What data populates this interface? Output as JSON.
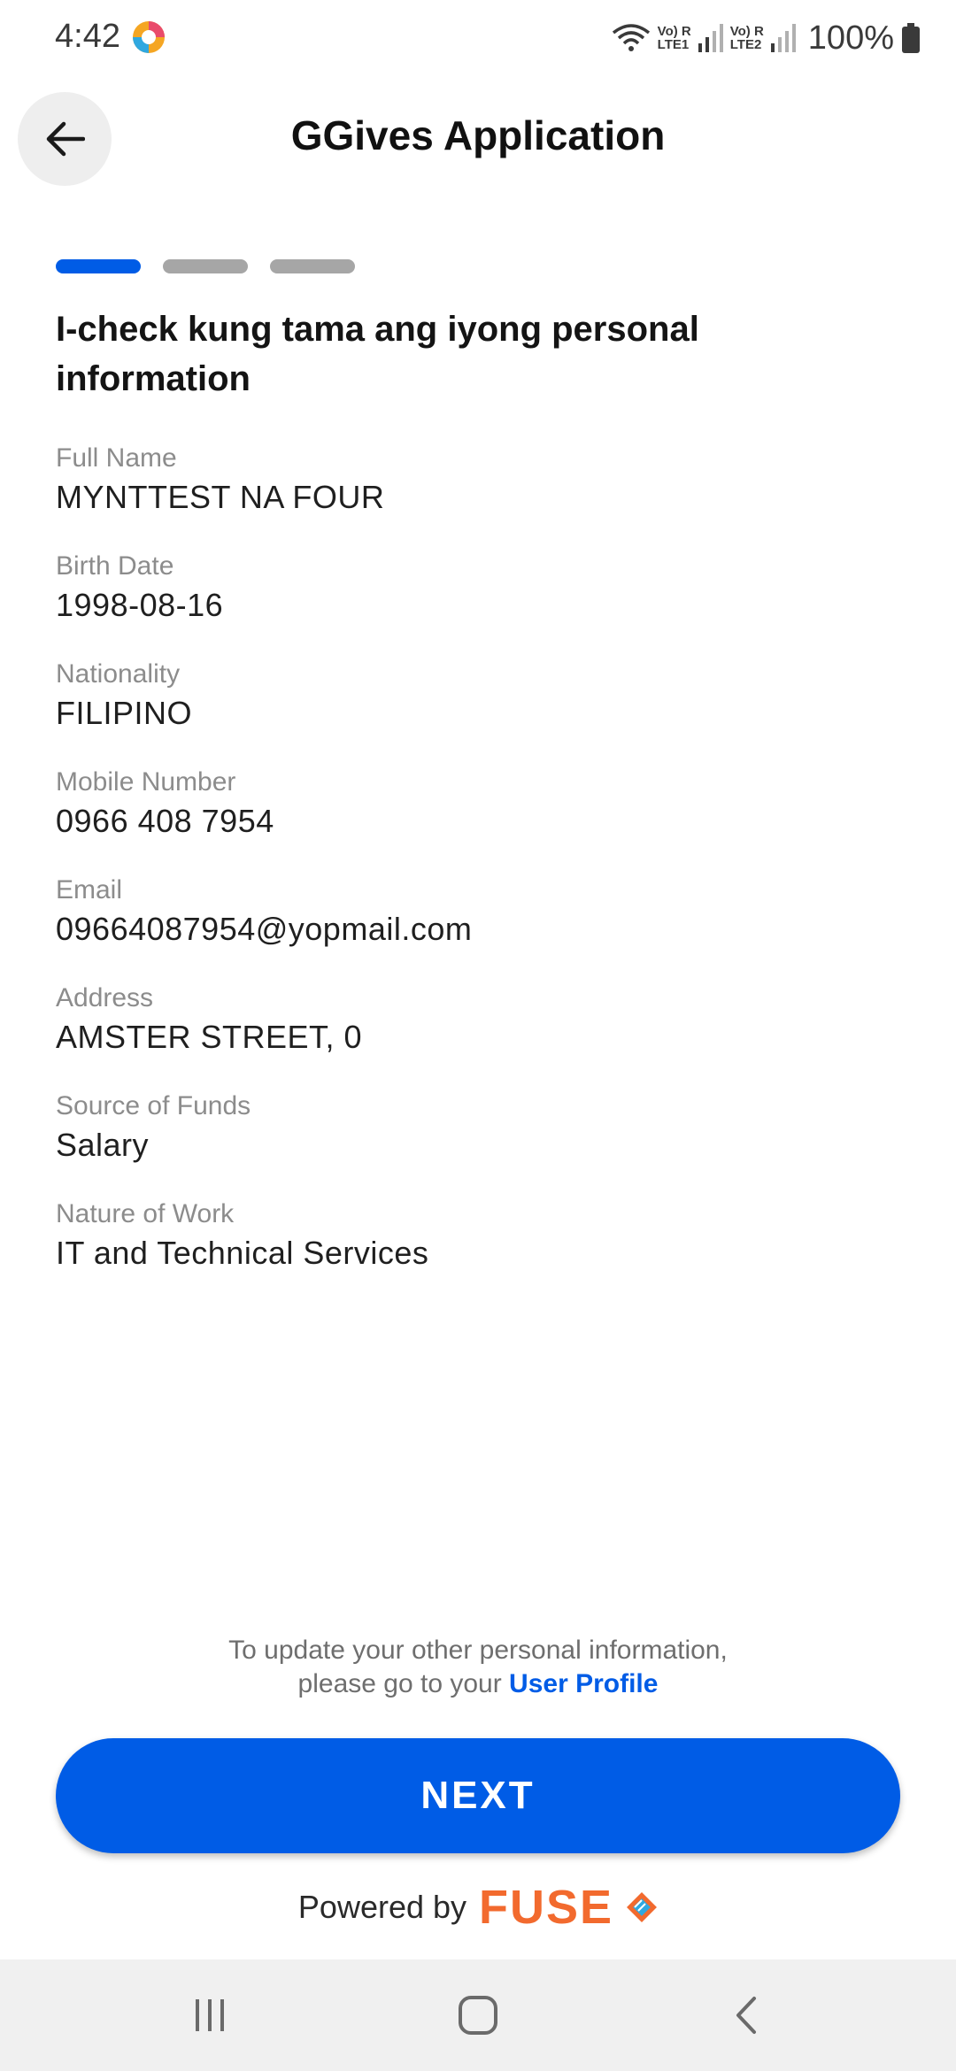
{
  "status_bar": {
    "time": "4:42",
    "sim1": "Vo) R\nLTE1",
    "sim2": "Vo) R\nLTE2",
    "battery": "100%"
  },
  "header": {
    "title": "GGives Application",
    "back_icon": "arrow-left-icon"
  },
  "progress": {
    "total_steps": 3,
    "current_step": 1
  },
  "heading": "I-check kung tama ang iyong personal information",
  "fields": [
    {
      "label": "Full Name",
      "value": "MYNTTEST NA FOUR"
    },
    {
      "label": "Birth Date",
      "value": "1998-08-16"
    },
    {
      "label": "Nationality",
      "value": "FILIPINO"
    },
    {
      "label": "Mobile Number",
      "value": "0966 408 7954"
    },
    {
      "label": "Email",
      "value": "09664087954@yopmail.com"
    },
    {
      "label": "Address",
      "value": "AMSTER STREET, 0"
    },
    {
      "label": "Source of Funds",
      "value": "Salary"
    },
    {
      "label": "Nature of Work",
      "value": "IT and Technical Services"
    }
  ],
  "note": {
    "line1": "To update your other personal information,",
    "line2_prefix": "please go to your",
    "link": "User Profile"
  },
  "next_button": "NEXT",
  "footer": {
    "powered_by": "Powered by",
    "brand": "FUSE"
  },
  "colors": {
    "primary": "#005ce6",
    "brand_orange": "#f26a2e",
    "inactive_step": "#a6a6a6"
  }
}
